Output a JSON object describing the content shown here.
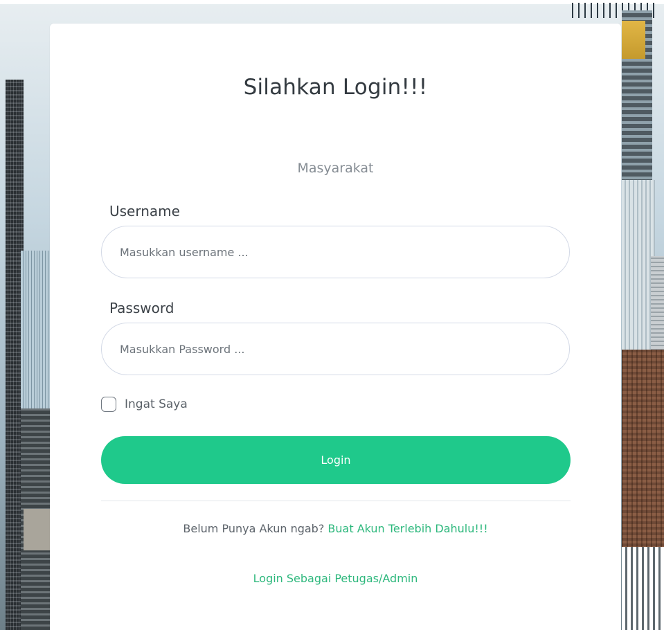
{
  "login": {
    "title": "Silahkan Login!!!",
    "subtitle": "Masyarakat",
    "username_label": "Username",
    "username_placeholder": "Masukkan username ...",
    "password_label": "Password",
    "password_placeholder": "Masukkan Password ...",
    "remember_label": "Ingat Saya",
    "remember_checked": false,
    "login_button": "Login",
    "register_prompt": "Belum Punya Akun ngab?",
    "register_link": "Buat Akun Terlebih Dahulu!!!",
    "admin_link": "Login Sebagai Petugas/Admin"
  },
  "theme": {
    "accent": "#1fc98b",
    "link": "#2eb87d",
    "card_background": "#ffffff"
  }
}
